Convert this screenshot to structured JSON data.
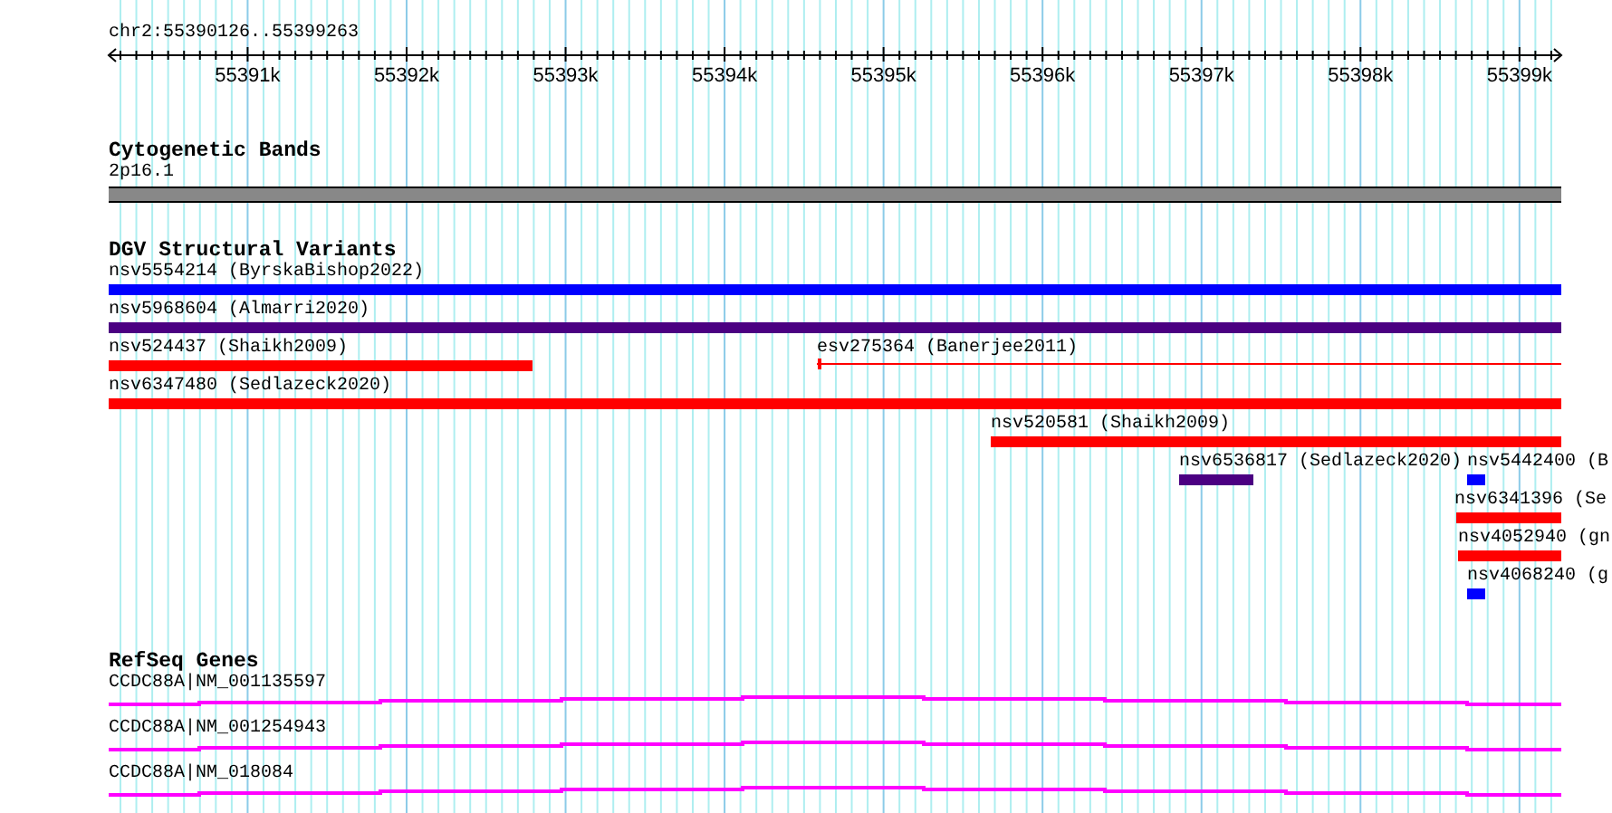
{
  "ruler": {
    "location": "chr2:55390126..55399263",
    "ticks": [
      "55391k",
      "55392k",
      "55393k",
      "55394k",
      "55395k",
      "55396k",
      "55397k",
      "55398k",
      "55399k"
    ]
  },
  "tracks": [
    {
      "kind": "cytoband",
      "title": "Cytogenetic Bands",
      "features": [
        {
          "label": "2p16.1"
        }
      ]
    },
    {
      "kind": "variants",
      "title": "DGV Structural Variants",
      "rows": [
        [
          {
            "label": "nsv5554214 (ByrskaBishop2022)",
            "kind": "bar",
            "color": "#0000ff"
          }
        ],
        [
          {
            "label": "nsv5968604 (Almarri2020)",
            "kind": "bar",
            "color": "#4b0082"
          }
        ],
        [
          {
            "label": "nsv524437 (Shaikh2009)",
            "kind": "bar",
            "color": "#ff0000"
          },
          {
            "label": "esv275364 (Banerjee2011)",
            "kind": "line",
            "color": "#ff0000"
          }
        ],
        [
          {
            "label": "nsv6347480 (Sedlazeck2020)",
            "kind": "bar",
            "color": "#ff0000"
          }
        ],
        [
          {
            "label": "nsv520581 (Shaikh2009)",
            "kind": "bar",
            "color": "#ff0000"
          }
        ],
        [
          {
            "label": "nsv6536817 (Sedlazeck2020)",
            "kind": "bar",
            "color": "#4b0082"
          },
          {
            "label": "nsv5442400 (B",
            "kind": "bar",
            "color": "#0000ff"
          }
        ],
        [
          {
            "label": "nsv6341396 (Se",
            "kind": "bar",
            "color": "#ff0000"
          }
        ],
        [
          {
            "label": "nsv4052940 (gn",
            "kind": "bar",
            "color": "#ff0000"
          }
        ],
        [
          {
            "label": "nsv4068240 (g",
            "kind": "bar",
            "color": "#0000ff"
          }
        ]
      ]
    },
    {
      "kind": "genes",
      "title": "RefSeq Genes",
      "features": [
        {
          "label": "CCDC88A|NM_001135597"
        },
        {
          "label": "CCDC88A|NM_001254943"
        },
        {
          "label": "CCDC88A|NM_018084"
        }
      ]
    }
  ]
}
